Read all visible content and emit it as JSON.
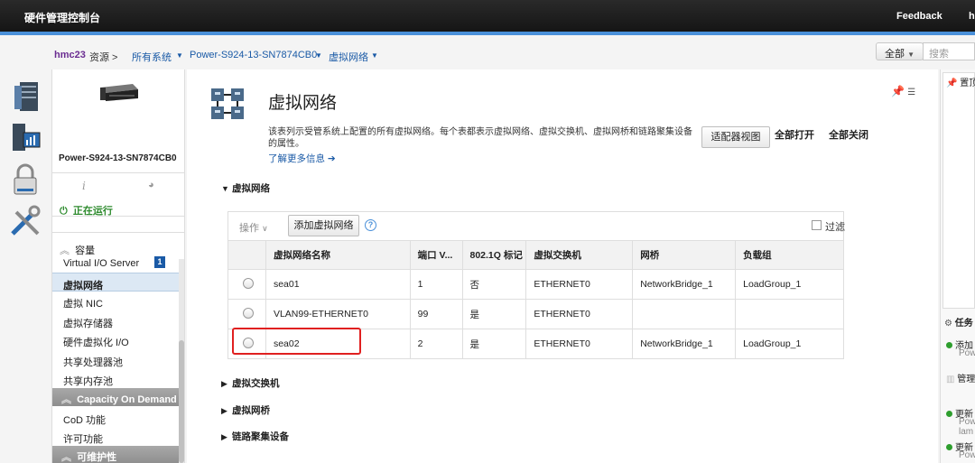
{
  "app": {
    "title": "硬件管理控制台",
    "feedback": "Feedback",
    "help_partial": "h"
  },
  "breadcrumb": {
    "host": "hmc23",
    "resources": "资源 >",
    "all_systems": "所有系统",
    "system": "Power-S924-13-SN7874CB0",
    "current": "虚拟网络"
  },
  "search": {
    "scope": "全部",
    "placeholder": "搜索"
  },
  "nav": {
    "server_name": "Power-S924-13-SN7874CB0",
    "status": "正在运行",
    "capacity_header": "容量",
    "vios_badge": "1",
    "items": [
      {
        "label": "Virtual I/O Server"
      },
      {
        "label": "虚拟网络"
      },
      {
        "label": "虚拟 NIC"
      },
      {
        "label": "虚拟存储器"
      },
      {
        "label": "硬件虚拟化 I/O"
      },
      {
        "label": "共享处理器池"
      },
      {
        "label": "共享内存池"
      }
    ],
    "cod_header": "Capacity On Demand",
    "cod_items": [
      {
        "label": "CoD 功能"
      },
      {
        "label": "许可功能"
      }
    ],
    "maint_header": "可维护性"
  },
  "main": {
    "title": "虚拟网络",
    "description": "该表列示受管系统上配置的所有虚拟网络。每个表都表示虚拟网络、虚拟交换机、虚拟网桥和链路聚集设备的属性。",
    "learn_more": "了解更多信息 ➔",
    "adapter_view": "适配器视图",
    "expand_all": "全部打开",
    "collapse_all": "全部关闭",
    "section_networks": "虚拟网络",
    "actions": "操作",
    "add_network": "添加虚拟网络",
    "filter": "过滤",
    "columns": [
      "虚拟网络名称",
      "端口 V...",
      "802.1Q 标记",
      "虚拟交换机",
      "网桥",
      "负载组"
    ],
    "rows": [
      [
        "sea01",
        "1",
        "否",
        "ETHERNET0",
        "NetworkBridge_1",
        "LoadGroup_1"
      ],
      [
        "VLAN99-ETHERNET0",
        "99",
        "是",
        "ETHERNET0",
        "",
        ""
      ],
      [
        "sea02",
        "2",
        "是",
        "ETHERNET0",
        "NetworkBridge_1",
        "LoadGroup_1"
      ]
    ],
    "section_switches": "虚拟交换机",
    "section_bridges": "虚拟网桥",
    "section_link_agg": "链路聚集设备"
  },
  "right_panel": {
    "pin_label": "置顶",
    "tasks_label": "任务",
    "task1": "添加",
    "task1_sub": "Pow",
    "manage": "管理",
    "task2": "更新",
    "task2_sub": "Pow",
    "task2_sub2": "lam",
    "task3": "更新",
    "task3_sub": "Pow"
  }
}
